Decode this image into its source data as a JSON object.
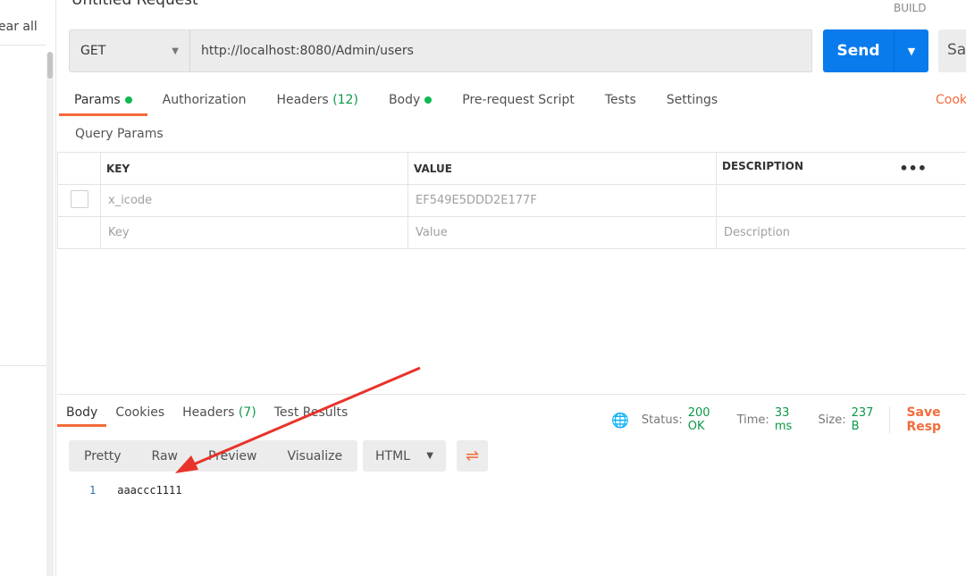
{
  "sidebar": {
    "clear_all": "ear all"
  },
  "header": {
    "title": "Untitled Request",
    "build": "BUILD"
  },
  "request": {
    "method": "GET",
    "url": "http://localhost:8080/Admin/users",
    "send": "Send",
    "save": "Sav"
  },
  "tabs": [
    {
      "label": "Params"
    },
    {
      "label": "Authorization"
    },
    {
      "label": "Headers",
      "count": "(12)"
    },
    {
      "label": "Body"
    },
    {
      "label": "Pre-request Script"
    },
    {
      "label": "Tests"
    },
    {
      "label": "Settings"
    }
  ],
  "cookies_link": "Cook",
  "query_params": {
    "title": "Query Params",
    "headers": [
      "KEY",
      "VALUE",
      "DESCRIPTION"
    ],
    "rows": [
      {
        "key": "x_icode",
        "value": "EF549E5DDD2E177F",
        "description": ""
      }
    ],
    "placeholder": {
      "key": "Key",
      "value": "Value",
      "description": "Description"
    }
  },
  "response": {
    "tabs": [
      {
        "label": "Body"
      },
      {
        "label": "Cookies"
      },
      {
        "label": "Headers",
        "count": "(7)"
      },
      {
        "label": "Test Results"
      }
    ],
    "status_label": "Status:",
    "status": "200 OK",
    "time_label": "Time:",
    "time": "33 ms",
    "size_label": "Size:",
    "size": "237 B",
    "save": "Save Resp",
    "views": [
      "Pretty",
      "Raw",
      "Preview",
      "Visualize"
    ],
    "format": "HTML",
    "lines": [
      {
        "n": "1",
        "text": "aaaccc1111"
      }
    ]
  },
  "colors": {
    "accent": "#f26b3a",
    "send": "#097bed",
    "ok": "#0a9a47",
    "arrow": "#e8332a"
  }
}
